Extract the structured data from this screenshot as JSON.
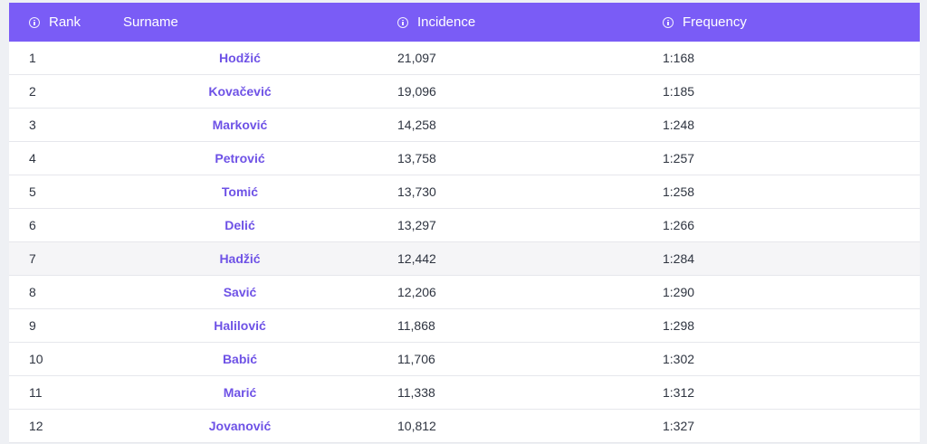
{
  "table": {
    "headers": {
      "rank": "Rank",
      "surname": "Surname",
      "incidence": "Incidence",
      "frequency": "Frequency"
    },
    "icons": {
      "header_info": "info-icon"
    },
    "colors": {
      "header_bg": "#7a5cf6",
      "link": "#6e52e6",
      "highlight_row": "#f5f5f7"
    },
    "rows": [
      {
        "rank": "1",
        "surname": "Hodžić",
        "incidence": "21,097",
        "frequency": "1:168"
      },
      {
        "rank": "2",
        "surname": "Kovačević",
        "incidence": "19,096",
        "frequency": "1:185"
      },
      {
        "rank": "3",
        "surname": "Marković",
        "incidence": "14,258",
        "frequency": "1:248"
      },
      {
        "rank": "4",
        "surname": "Petrović",
        "incidence": "13,758",
        "frequency": "1:257"
      },
      {
        "rank": "5",
        "surname": "Tomić",
        "incidence": "13,730",
        "frequency": "1:258"
      },
      {
        "rank": "6",
        "surname": "Delić",
        "incidence": "13,297",
        "frequency": "1:266"
      },
      {
        "rank": "7",
        "surname": "Hadžić",
        "incidence": "12,442",
        "frequency": "1:284"
      },
      {
        "rank": "8",
        "surname": "Savić",
        "incidence": "12,206",
        "frequency": "1:290"
      },
      {
        "rank": "9",
        "surname": "Halilović",
        "incidence": "11,868",
        "frequency": "1:298"
      },
      {
        "rank": "10",
        "surname": "Babić",
        "incidence": "11,706",
        "frequency": "1:302"
      },
      {
        "rank": "11",
        "surname": "Marić",
        "incidence": "11,338",
        "frequency": "1:312"
      },
      {
        "rank": "12",
        "surname": "Jovanović",
        "incidence": "10,812",
        "frequency": "1:327"
      }
    ]
  }
}
